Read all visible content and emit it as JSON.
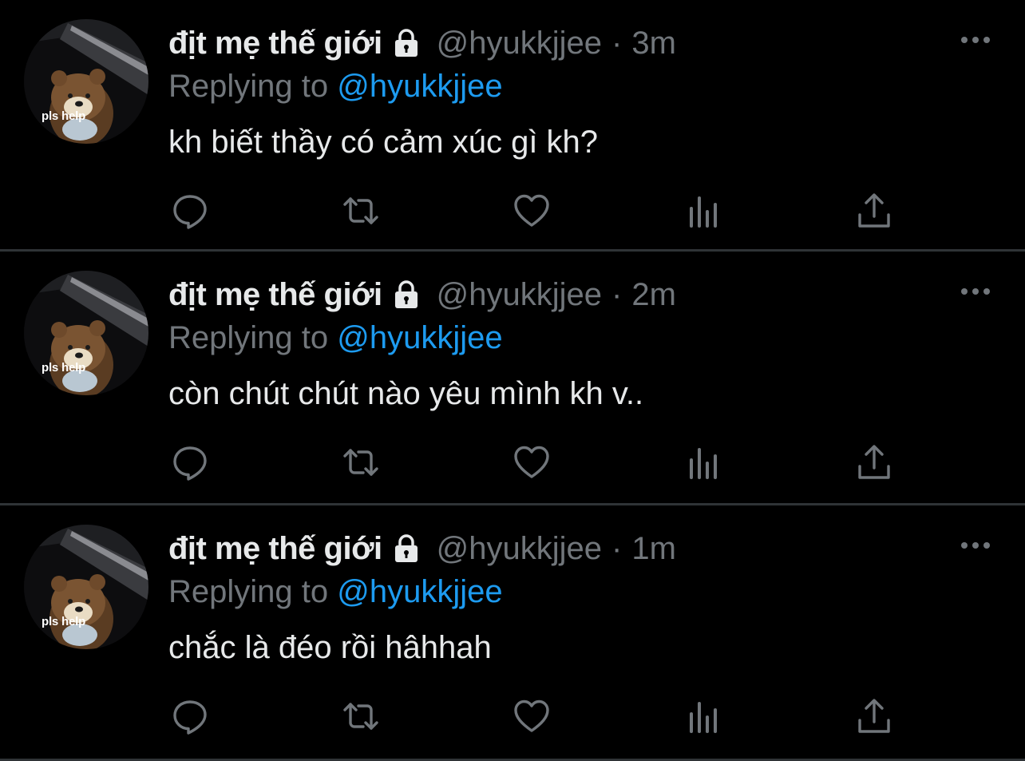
{
  "colors": {
    "background": "#000000",
    "primary_text": "#e7e9ea",
    "secondary_text": "#71767b",
    "mention": "#1d9bf0",
    "divider": "#2f3336"
  },
  "tweets": [
    {
      "avatar_caption": "pls help",
      "display_name": "địt mẹ thế giới",
      "protected_icon": "lock-icon",
      "handle": "@hyukkjjee",
      "separator": "·",
      "time": "3m",
      "replying_prefix": "Replying to",
      "replying_to": "@hyukkjjee",
      "text": "kh biết thầy có cảm xúc gì kh?",
      "actions": [
        "reply-icon",
        "retweet-icon",
        "like-icon",
        "views-icon",
        "share-icon"
      ]
    },
    {
      "avatar_caption": "pls help",
      "display_name": "địt mẹ thế giới",
      "protected_icon": "lock-icon",
      "handle": "@hyukkjjee",
      "separator": "·",
      "time": "2m",
      "replying_prefix": "Replying to",
      "replying_to": "@hyukkjjee",
      "text": "còn chút chút nào yêu mình kh v..",
      "actions": [
        "reply-icon",
        "retweet-icon",
        "like-icon",
        "views-icon",
        "share-icon"
      ]
    },
    {
      "avatar_caption": "pls help",
      "display_name": "địt mẹ thế giới",
      "protected_icon": "lock-icon",
      "handle": "@hyukkjjee",
      "separator": "·",
      "time": "1m",
      "replying_prefix": "Replying to",
      "replying_to": "@hyukkjjee",
      "text": "chắc là đéo rồi hâhhah",
      "actions": [
        "reply-icon",
        "retweet-icon",
        "like-icon",
        "views-icon",
        "share-icon"
      ]
    }
  ]
}
